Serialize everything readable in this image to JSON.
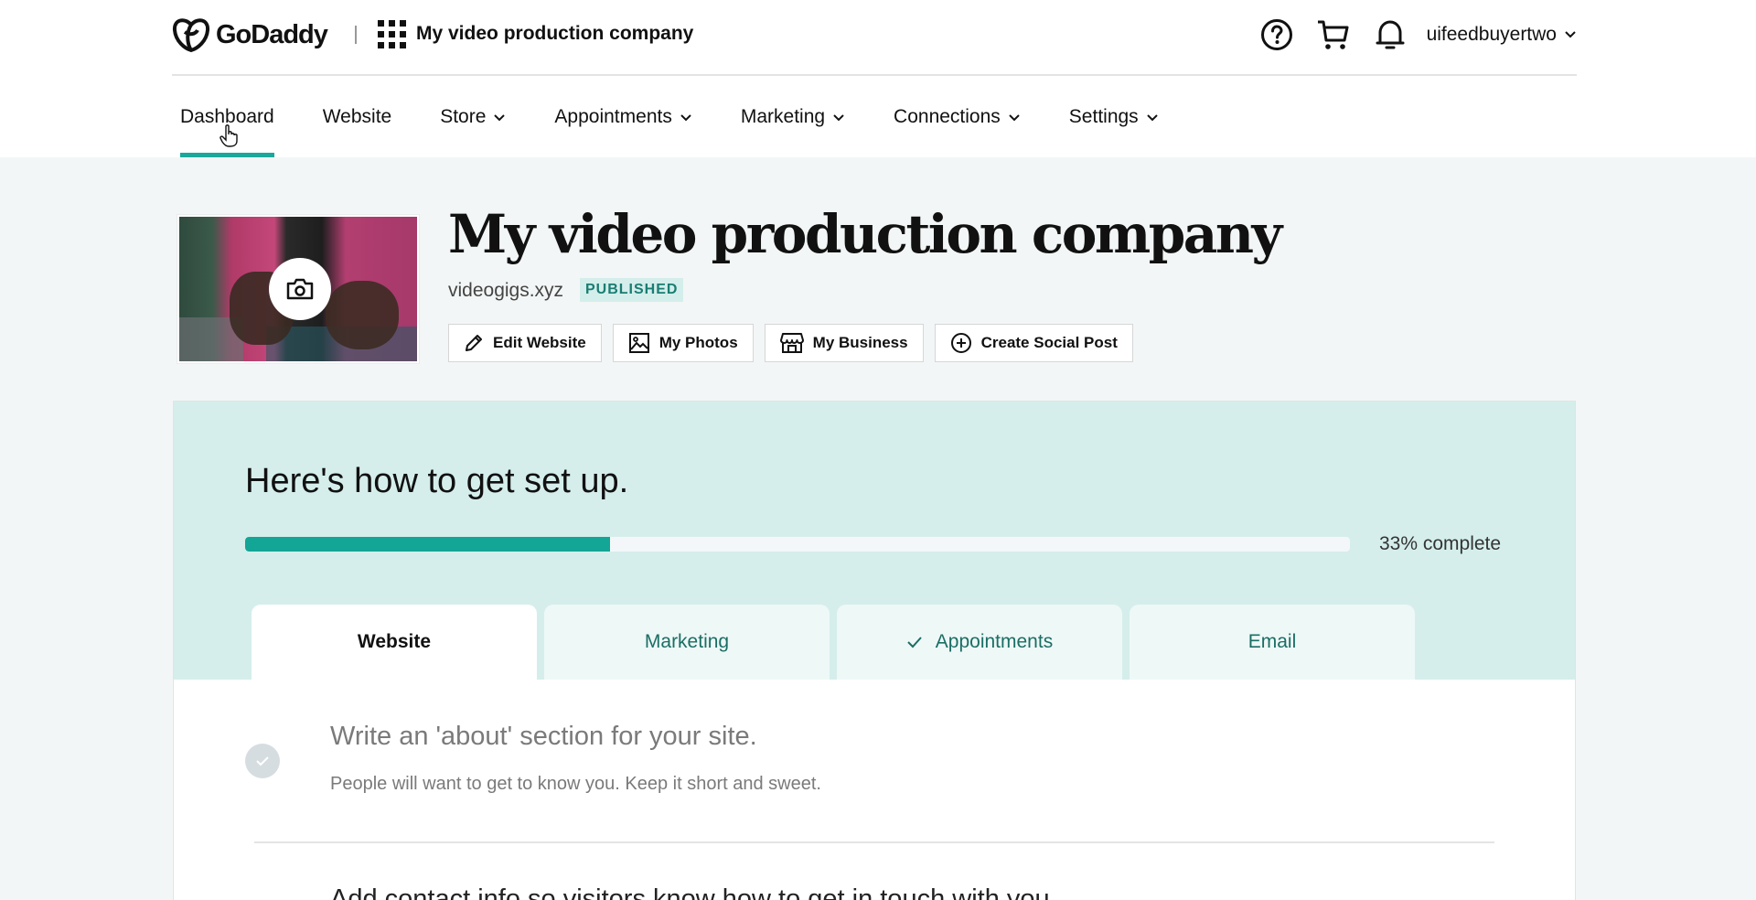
{
  "header": {
    "brand": "GoDaddy",
    "site_name": "My video production company",
    "username": "uifeedbuyertwo",
    "icons": [
      "help-icon",
      "cart-icon",
      "bell-icon"
    ]
  },
  "nav": {
    "items": [
      {
        "label": "Dashboard",
        "active": true,
        "dropdown": false
      },
      {
        "label": "Website",
        "active": false,
        "dropdown": false
      },
      {
        "label": "Store",
        "active": false,
        "dropdown": true
      },
      {
        "label": "Appointments",
        "active": false,
        "dropdown": true
      },
      {
        "label": "Marketing",
        "active": false,
        "dropdown": true
      },
      {
        "label": "Connections",
        "active": false,
        "dropdown": true
      },
      {
        "label": "Settings",
        "active": false,
        "dropdown": true
      }
    ]
  },
  "site": {
    "title": "My video production company",
    "domain": "videogigs.xyz",
    "status": "PUBLISHED",
    "actions": [
      {
        "label": "Edit Website",
        "icon": "pencil-icon"
      },
      {
        "label": "My Photos",
        "icon": "image-icon"
      },
      {
        "label": "My Business",
        "icon": "storefront-icon"
      },
      {
        "label": "Create Social Post",
        "icon": "plus-circle-icon"
      }
    ]
  },
  "setup": {
    "title": "Here's how to get set up.",
    "progress_percent": 33,
    "progress_label": "33% complete",
    "tabs": [
      {
        "label": "Website",
        "active": true,
        "completed": false
      },
      {
        "label": "Marketing",
        "active": false,
        "completed": false
      },
      {
        "label": "Appointments",
        "active": false,
        "completed": true
      },
      {
        "label": "Email",
        "active": false,
        "completed": false
      }
    ],
    "tasks": [
      {
        "title": "Write an 'about' section for your site.",
        "description": "People will want to get to know you. Keep it short and sweet.",
        "completed": true
      },
      {
        "title": "Add contact info so visitors know how to get in touch with you.",
        "description": "",
        "completed": false
      }
    ]
  },
  "colors": {
    "accent": "#1ba89a",
    "setup_bg": "#d5eeeb",
    "badge_bg": "#d4eeeb",
    "badge_text": "#1a7d72"
  }
}
